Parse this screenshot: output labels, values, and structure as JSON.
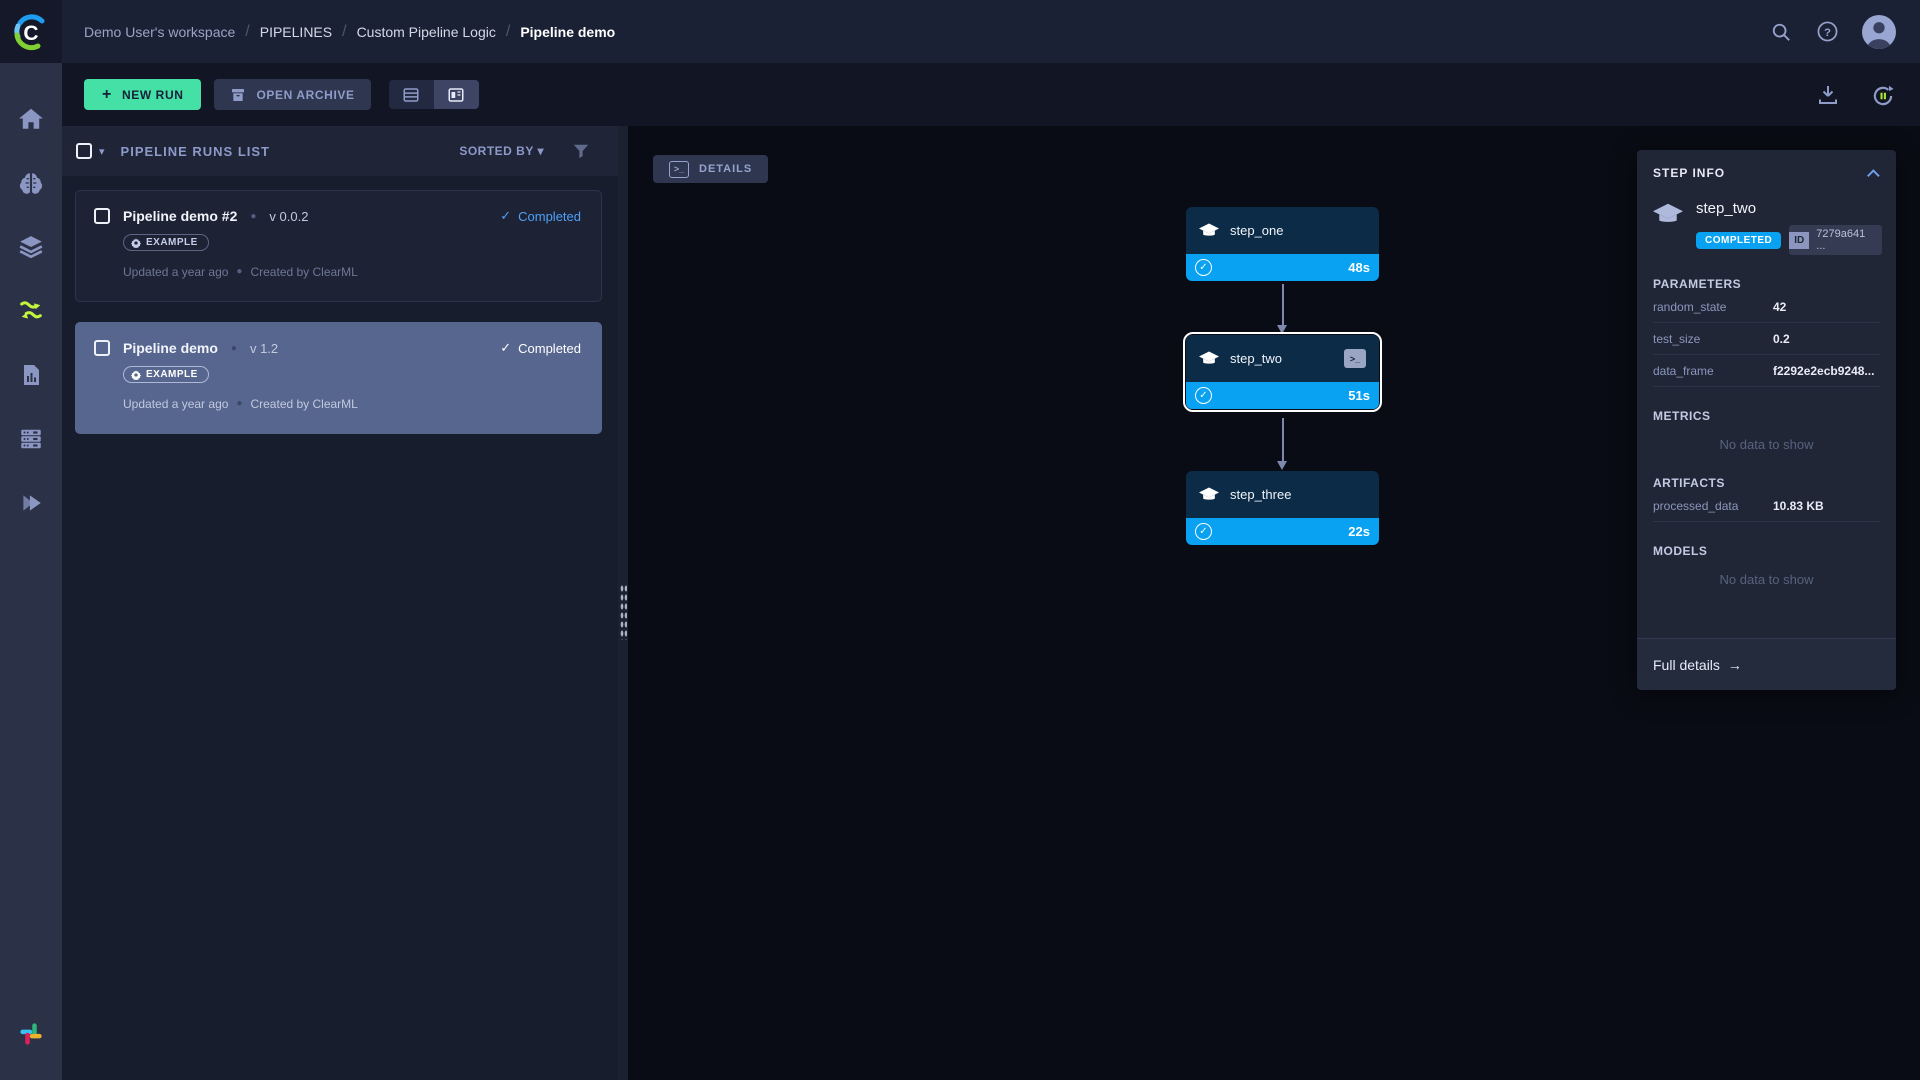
{
  "header": {
    "breadcrumbs": [
      "Demo User's workspace",
      "PIPELINES",
      "Custom Pipeline Logic",
      "Pipeline demo"
    ],
    "help_glyph": "?"
  },
  "toolbar": {
    "new_run_label": "NEW RUN",
    "new_run_plus": "+",
    "open_archive_label": "OPEN ARCHIVE"
  },
  "runs_panel": {
    "title": "PIPELINE RUNS LIST",
    "sorted_by_label": "SORTED BY",
    "caret": "▾",
    "dot": "●",
    "check": "✓",
    "runs": [
      {
        "name": "Pipeline demo #2",
        "version": "v 0.0.2",
        "status": "Completed",
        "tag": "EXAMPLE",
        "updated": "Updated a year ago",
        "created": "Created by ClearML"
      },
      {
        "name": "Pipeline demo",
        "version": "v 1.2",
        "status": "Completed",
        "tag": "EXAMPLE",
        "updated": "Updated a year ago",
        "created": "Created by ClearML"
      }
    ]
  },
  "canvas": {
    "details_label": "DETAILS",
    "terminal_glyph": ">_",
    "check": "✓",
    "nodes": [
      {
        "name": "step_one",
        "duration": "48s"
      },
      {
        "name": "step_two",
        "duration": "51s"
      },
      {
        "name": "step_three",
        "duration": "22s"
      }
    ]
  },
  "step_info": {
    "title": "STEP INFO",
    "step_name": "step_two",
    "status_badge": "COMPLETED",
    "id_label": "ID",
    "id_value": "7279a641 ...",
    "parameters_title": "PARAMETERS",
    "parameters": [
      {
        "label": "random_state",
        "value": "42"
      },
      {
        "label": "test_size",
        "value": "0.2"
      },
      {
        "label": "data_frame",
        "value": "f2292e2ecb9248..."
      }
    ],
    "metrics_title": "METRICS",
    "metrics_empty": "No data to show",
    "artifacts_title": "ARTIFACTS",
    "artifacts": [
      {
        "label": "processed_data",
        "value": "10.83 KB"
      }
    ],
    "models_title": "MODELS",
    "models_empty": "No data to show",
    "full_details_label": "Full details",
    "arrow_right": "→"
  },
  "colors": {
    "accent_blue": "#09a2f2",
    "accent_green": "#45e0a5",
    "pipeline_icon_green": "#c3f53d",
    "status_blue": "#4ea1f7",
    "selected_card": "#57668f"
  }
}
